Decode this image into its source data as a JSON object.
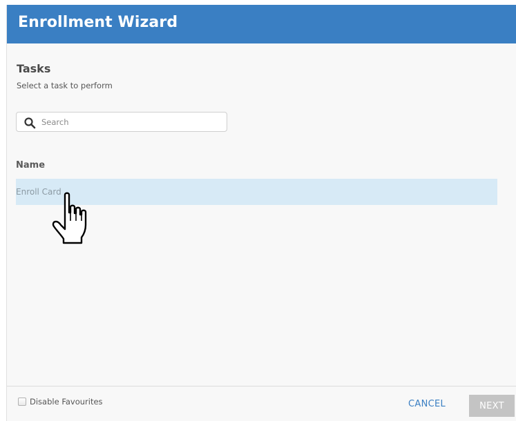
{
  "dialog": {
    "title": "Enrollment Wizard",
    "accent_color": "#3a7fc3"
  },
  "section": {
    "heading": "Tasks",
    "subheading": "Select a task to perform"
  },
  "search": {
    "icon": "search-icon",
    "placeholder": "Search",
    "value": ""
  },
  "table": {
    "column_header": "Name",
    "rows": [
      {
        "name": "Enroll Card",
        "highlighted": true
      }
    ]
  },
  "footer": {
    "disable_favourites_label": "Disable Favourites",
    "disable_favourites_checked": false,
    "cancel_label": "CANCEL",
    "next_label": "NEXT"
  },
  "cursor": {
    "icon": "hand-pointer-icon"
  }
}
